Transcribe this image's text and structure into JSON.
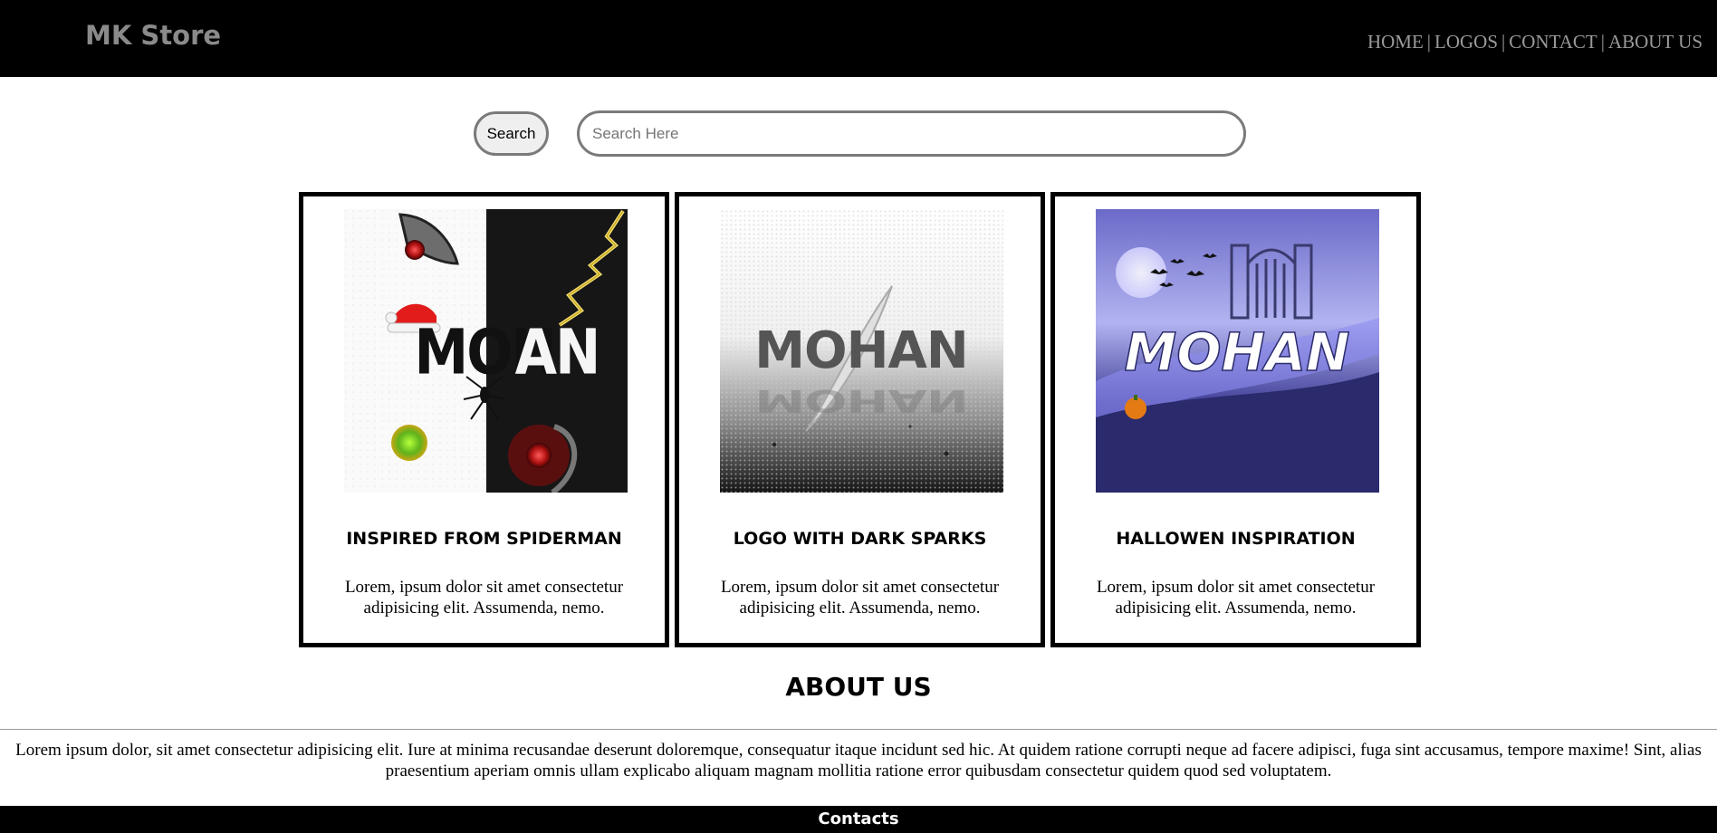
{
  "header": {
    "brand": "MK Store",
    "nav": [
      {
        "label": "HOME"
      },
      {
        "label": "LOGOS"
      },
      {
        "label": "CONTACT"
      },
      {
        "label": "ABOUT US"
      }
    ],
    "separator": "|"
  },
  "search": {
    "button_label": "Search",
    "placeholder": "Search Here",
    "value": ""
  },
  "cards": [
    {
      "title": "INSPIRED FROM SPIDERMAN",
      "description": "Lorem, ipsum dolor sit amet consectetur adipisicing elit. Assumenda, nemo.",
      "image_text": "MOHAN"
    },
    {
      "title": "LOGO WITH DARK SPARKS",
      "description": "Lorem, ipsum dolor sit amet consectetur adipisicing elit. Assumenda, nemo.",
      "image_text": "MOHAN"
    },
    {
      "title": "HALLOWEN INSPIRATION",
      "description": "Lorem, ipsum dolor sit amet consectetur adipisicing elit. Assumenda, nemo.",
      "image_text": "MOHAN"
    }
  ],
  "about": {
    "title": "ABOUT US",
    "text": "Lorem ipsum dolor, sit amet consectetur adipisicing elit. Iure at minima recusandae deserunt doloremque, consequatur itaque incidunt sed hic. At quidem ratione corrupti neque ad facere adipisci, fuga sint accusamus, tempore maxime! Sint, alias praesentium aperiam omnis ullam explicabo aliquam magnam mollitia ratione error quibusdam consectetur quidem quod sed voluptatem."
  },
  "footer": {
    "label": "Contacts"
  },
  "colors": {
    "header_bg": "#000000",
    "brand_text": "#8a8a8a",
    "nav_text": "#9a9a9a",
    "card_border": "#000000",
    "footer_bg": "#000000"
  }
}
